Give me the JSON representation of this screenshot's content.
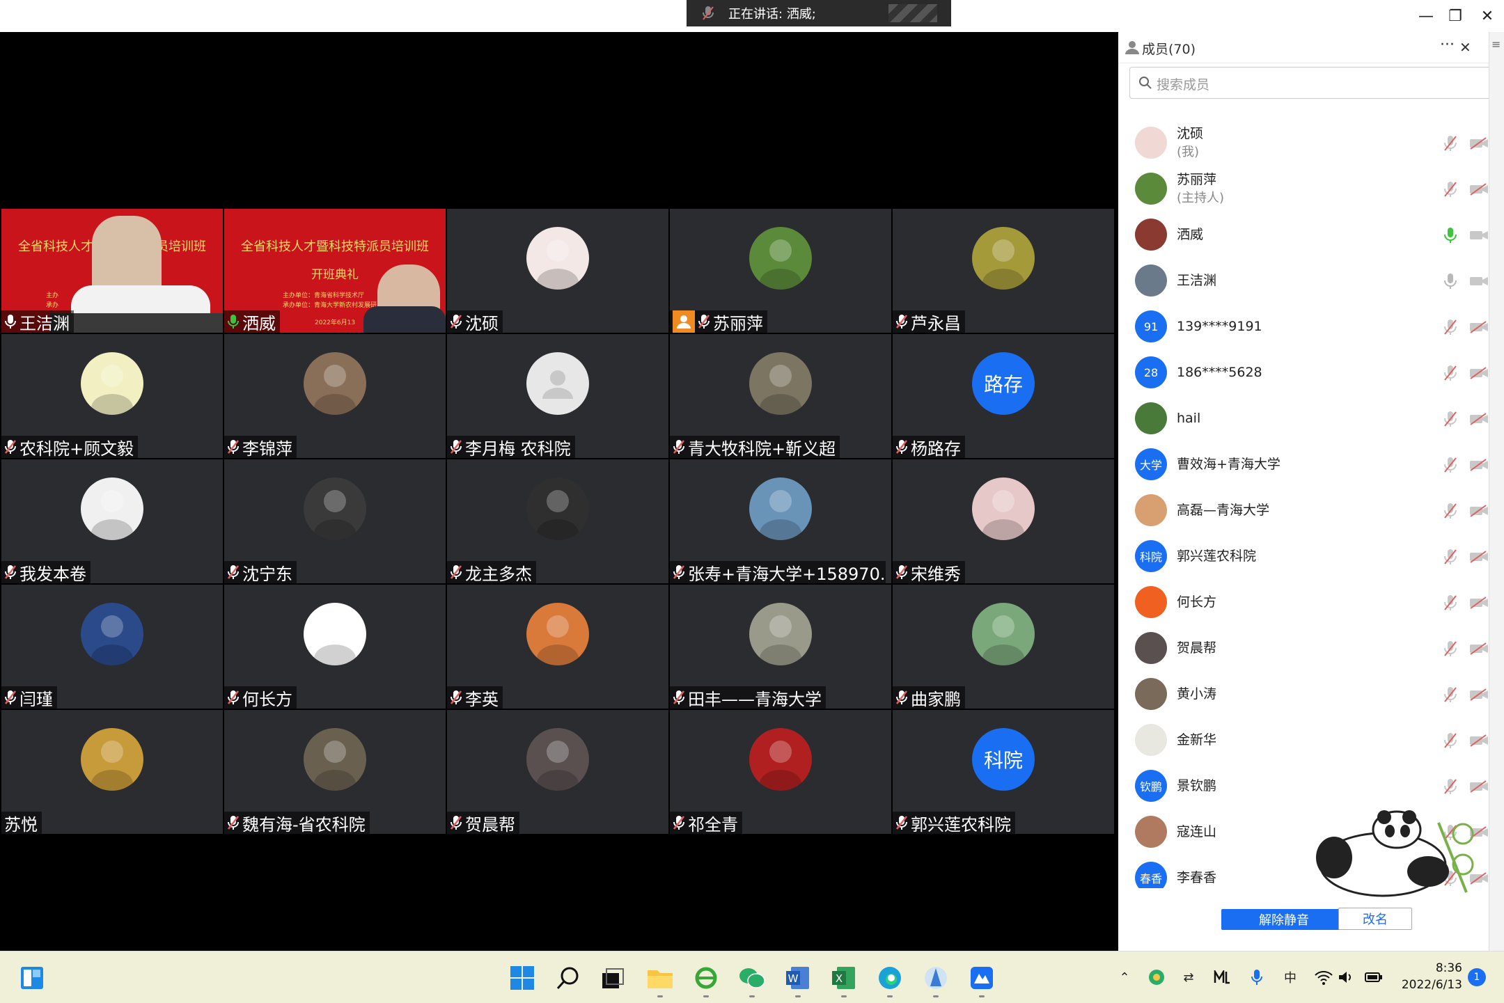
{
  "speaking_banner": "正在讲话: 洒威;",
  "window_controls": {
    "minimize": "—",
    "restore": "❐",
    "close": "✕"
  },
  "grid": [
    {
      "name": "王洁渊",
      "type": "slide_left",
      "mic": "white"
    },
    {
      "name": "洒威",
      "type": "slide_right",
      "mic": "green"
    },
    {
      "name": "沈硕",
      "type": "avatar",
      "color": "#f3e8e6",
      "mic": "muted"
    },
    {
      "name": "苏丽萍",
      "type": "avatar",
      "color": "#5b8a3a",
      "mic": "muted",
      "host": true
    },
    {
      "name": "芦永昌",
      "type": "avatar",
      "color": "#a59a3a",
      "mic": "muted"
    },
    {
      "name": "农科院+顾文毅",
      "type": "avatar",
      "color": "#f2f0c2",
      "mic": "muted"
    },
    {
      "name": "李锦萍",
      "type": "avatar",
      "color": "#8a6f58",
      "mic": "muted"
    },
    {
      "name": "李月梅 农科院",
      "type": "avatar",
      "color": "#e7e7e7",
      "mic": "muted",
      "placeholder": true
    },
    {
      "name": "青大牧科院+靳义超",
      "type": "avatar",
      "color": "#7c7562",
      "mic": "muted"
    },
    {
      "name": "杨路存",
      "type": "text",
      "text": "路存",
      "color": "#1a6ef2",
      "mic": "muted"
    },
    {
      "name": "我发本卷",
      "type": "avatar",
      "color": "#f0f0f0",
      "mic": "muted"
    },
    {
      "name": "沈宁东",
      "type": "avatar",
      "color": "#3a3a3a",
      "mic": "muted"
    },
    {
      "name": "龙主多杰",
      "type": "avatar",
      "color": "#2f2f2f",
      "mic": "muted"
    },
    {
      "name": "张寿+青海大学+158970...",
      "type": "avatar",
      "color": "#6a93b8",
      "mic": "muted"
    },
    {
      "name": "宋维秀",
      "type": "avatar",
      "color": "#e7c8c8",
      "mic": "muted"
    },
    {
      "name": "闫瑾",
      "type": "avatar",
      "color": "#2a4a8a",
      "mic": "muted"
    },
    {
      "name": "何长方",
      "type": "avatar",
      "color": "#ffffff",
      "mic": "muted"
    },
    {
      "name": "李英",
      "type": "avatar",
      "color": "#d97a3b",
      "mic": "muted"
    },
    {
      "name": "田丰——青海大学",
      "type": "avatar",
      "color": "#9a9a8a",
      "mic": "muted"
    },
    {
      "name": "曲家鹏",
      "type": "avatar",
      "color": "#7aa87a",
      "mic": "muted"
    },
    {
      "name": "苏悦",
      "type": "avatar",
      "color": "#c79a3a",
      "mic": "none"
    },
    {
      "name": "魏有海-省农科院",
      "type": "avatar",
      "color": "#6a6050",
      "mic": "muted"
    },
    {
      "name": "贺晨帮",
      "type": "avatar",
      "color": "#5a5050",
      "mic": "muted"
    },
    {
      "name": "祁全青",
      "type": "avatar",
      "color": "#b02020",
      "mic": "muted"
    },
    {
      "name": "郭兴莲农科院",
      "type": "text",
      "text": "科院",
      "color": "#1a6ef2",
      "mic": "muted"
    }
  ],
  "slides": {
    "left_title": "全省科技人才暨科技特派员培训班",
    "right_title": "全省科技人才暨科技特派员培训班",
    "right_subtitle": "开班典礼",
    "right_org1": "主办单位：青海省科学技术厅",
    "right_org2": "承办单位：青海大学新农村发展研",
    "right_date": "2022年6月13",
    "left_org1": "主办",
    "left_org2": "承办"
  },
  "panel": {
    "title": "成员(70)",
    "more": "···",
    "close": "✕",
    "search_placeholder": "搜索成员",
    "members": [
      {
        "name": "沈硕",
        "sub": "(我)",
        "avatar_color": "#f0d8d4",
        "mic": "muted",
        "cam": "muted"
      },
      {
        "name": "苏丽萍",
        "sub": "(主持人)",
        "avatar_color": "#5b8a3a",
        "mic": "muted",
        "cam": "muted"
      },
      {
        "name": "洒威",
        "avatar_color": "#8a3a30",
        "mic": "green",
        "cam": "on"
      },
      {
        "name": "王洁渊",
        "avatar_color": "#6a7a8a",
        "mic": "grey",
        "cam": "on"
      },
      {
        "name": "139****9191",
        "avatar_text": "91",
        "avatar_color": "#1a6ef2",
        "mic": "muted",
        "cam": "muted"
      },
      {
        "name": "186****5628",
        "avatar_text": "28",
        "avatar_color": "#1a6ef2",
        "mic": "muted",
        "cam": "muted"
      },
      {
        "name": "hail",
        "avatar_color": "#4a7a3a",
        "mic": "muted",
        "cam": "muted"
      },
      {
        "name": "曹效海+青海大学",
        "avatar_text": "大学",
        "avatar_color": "#1a6ef2",
        "mic": "muted",
        "cam": "muted"
      },
      {
        "name": "高磊—青海大学",
        "avatar_color": "#d8a070",
        "mic": "muted",
        "cam": "muted"
      },
      {
        "name": "郭兴莲农科院",
        "avatar_text": "科院",
        "avatar_color": "#1a6ef2",
        "mic": "muted",
        "cam": "muted"
      },
      {
        "name": "何长方",
        "avatar_color": "#f06020",
        "mic": "muted",
        "cam": "muted"
      },
      {
        "name": "贺晨帮",
        "avatar_color": "#5a5050",
        "mic": "muted",
        "cam": "muted"
      },
      {
        "name": "黄小涛",
        "avatar_color": "#7a6a5a",
        "mic": "muted",
        "cam": "muted"
      },
      {
        "name": "金新华",
        "avatar_color": "#e8e8e0",
        "mic": "muted",
        "cam": "muted"
      },
      {
        "name": "景钦鹏",
        "avatar_text": "钦鹏",
        "avatar_color": "#1a6ef2",
        "mic": "muted",
        "cam": "muted"
      },
      {
        "name": "寇连山",
        "avatar_color": "#b07a60",
        "mic": "muted",
        "cam": "muted"
      },
      {
        "name": "李春香",
        "avatar_text": "春香",
        "avatar_color": "#1a6ef2",
        "mic": "muted",
        "cam": "muted"
      }
    ],
    "unmute_all": "解除静音",
    "rename": "改名"
  },
  "taskbar": {
    "time": "8:36",
    "date": "2022/6/13",
    "notifications": "1",
    "ime": "中"
  },
  "colors": {
    "accent": "#1a6ef2",
    "tile_bg": "#2a2c30",
    "muted_red": "#e06060",
    "mic_green": "#3cc43c"
  }
}
